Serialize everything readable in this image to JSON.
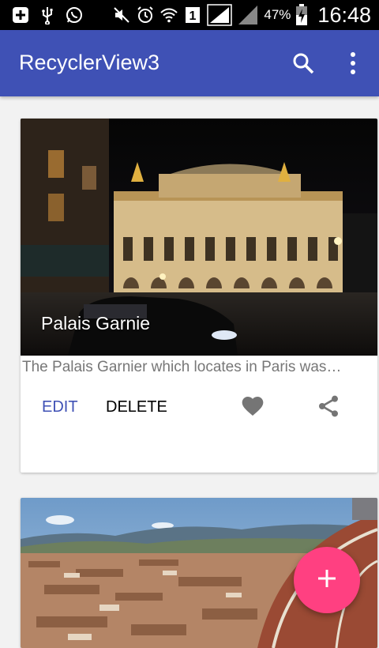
{
  "status_bar": {
    "battery_percent": "47%",
    "time": "16:48",
    "sim_indicator": "1",
    "icons": [
      "add-box-icon",
      "usb-icon",
      "whatsapp-icon",
      "mute-icon",
      "alarm-icon",
      "wifi-icon",
      "sim-icon",
      "signal-icon",
      "signal-icon",
      "battery-icon"
    ]
  },
  "app_bar": {
    "title": "RecyclerView3",
    "actions": [
      "search-icon",
      "more-vert-icon"
    ],
    "color": "#3f51b5"
  },
  "cards": [
    {
      "title": "Palais Garnie",
      "description": "The Palais Garnier which locates in Paris was…",
      "edit_label": "EDIT",
      "delete_label": "DELETE",
      "favorite_icon": "heart-icon",
      "share_icon": "share-icon"
    }
  ],
  "fab": {
    "icon": "plus-icon",
    "color": "#ff4081"
  }
}
